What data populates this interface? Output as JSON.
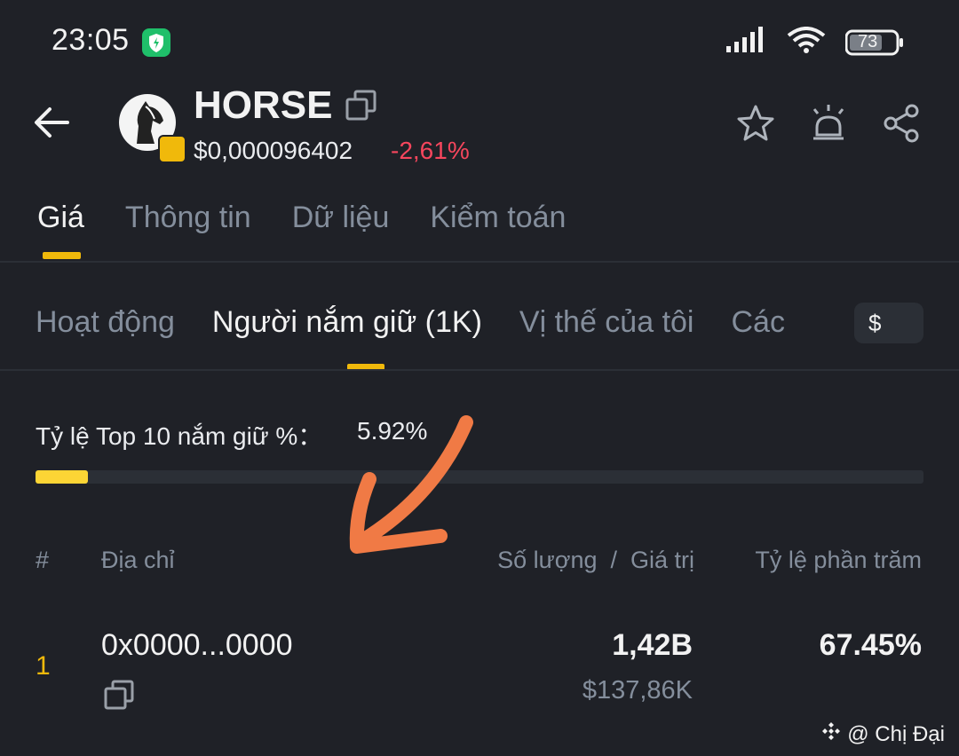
{
  "status_bar": {
    "time": "23:05",
    "battery": "73"
  },
  "header": {
    "token_name": "HORSE",
    "price": "$0,000096402",
    "change": "-2,61%",
    "change_color": "#f6465d"
  },
  "main_tabs": [
    {
      "label": "Giá",
      "active": true
    },
    {
      "label": "Thông tin",
      "active": false
    },
    {
      "label": "Dữ liệu",
      "active": false
    },
    {
      "label": "Kiểm toán",
      "active": false
    }
  ],
  "sub_tabs": [
    {
      "label": "Hoạt động",
      "active": false
    },
    {
      "label": "Người nắm giữ (1K)",
      "active": true
    },
    {
      "label": "Vị thế của tôi",
      "active": false
    },
    {
      "label": "Các",
      "active": false
    }
  ],
  "currency_toggle": "$",
  "top10": {
    "label": "Tỷ lệ Top 10 nắm giữ %：",
    "value": "5.92%",
    "fraction": 0.0592
  },
  "table": {
    "headers": {
      "rank": "#",
      "address": "Địa chỉ",
      "amount": "Số lượng  /  Giá trị",
      "percent": "Tỷ lệ phần trăm"
    },
    "rows": [
      {
        "rank": "1",
        "address": "0x0000...0000",
        "quantity": "1,42B",
        "value": "$137,86K",
        "percent": "67.45%"
      }
    ]
  },
  "watermark": "@ Chị Đại",
  "colors": {
    "accent": "#f0b90b",
    "background": "#1f2127",
    "annotation_arrow": "#f07a45"
  }
}
